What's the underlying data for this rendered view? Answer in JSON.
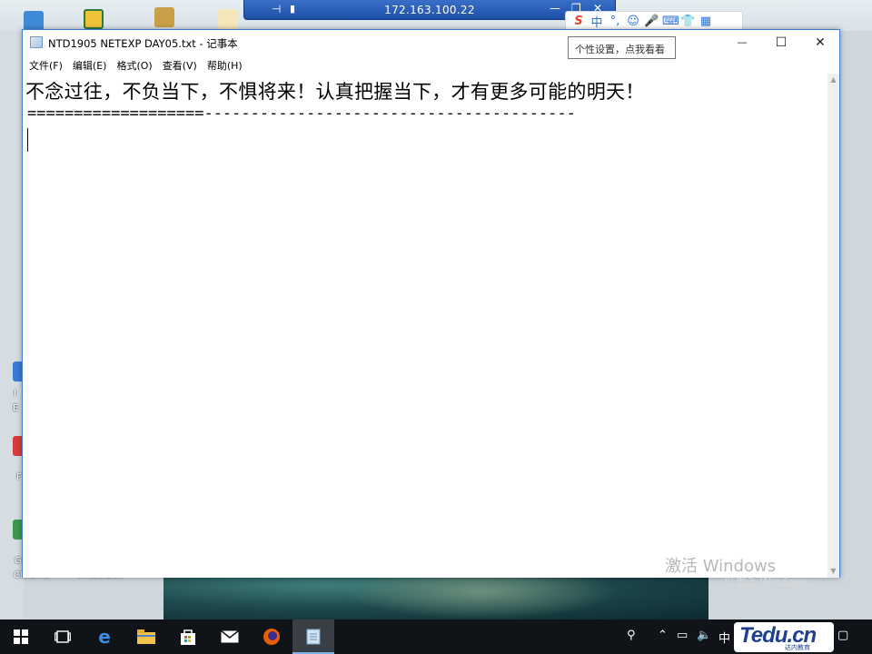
{
  "remote_bar": {
    "ip": "172.163.100.22"
  },
  "ime": {
    "tooltip": "个性设置，点我看看"
  },
  "window": {
    "title": "NTD1905 NETEXP DAY05.txt - 记事本",
    "controls": {
      "minimize": "—",
      "maximize": "☐",
      "close": "✕"
    }
  },
  "menu": {
    "items": [
      {
        "label": "文件(F)"
      },
      {
        "label": "编辑(E)"
      },
      {
        "label": "格式(O)"
      },
      {
        "label": "查看(V)"
      },
      {
        "label": "帮助(H)"
      }
    ]
  },
  "editor": {
    "line1": "不念过往，不负当下，不惧将来！认真把握当下，才有更多可能的明天！",
    "line2": "===================----------------------------------------"
  },
  "watermark": {
    "line1": "激活 Windows",
    "line2": "以激活 Windows。"
  },
  "desktop": {
    "labels": [
      "I",
      "E",
      "F",
      "G",
      "Chrome",
      "VirtualBox"
    ]
  },
  "taskbar": {
    "ime_label": "中",
    "logo_text": "Tedu.cn",
    "logo_sub": "达内教育"
  },
  "colors": {
    "window_border": "#3e7fd1",
    "rdp_bar": "#1d4fa8",
    "taskbar": "#101418"
  }
}
